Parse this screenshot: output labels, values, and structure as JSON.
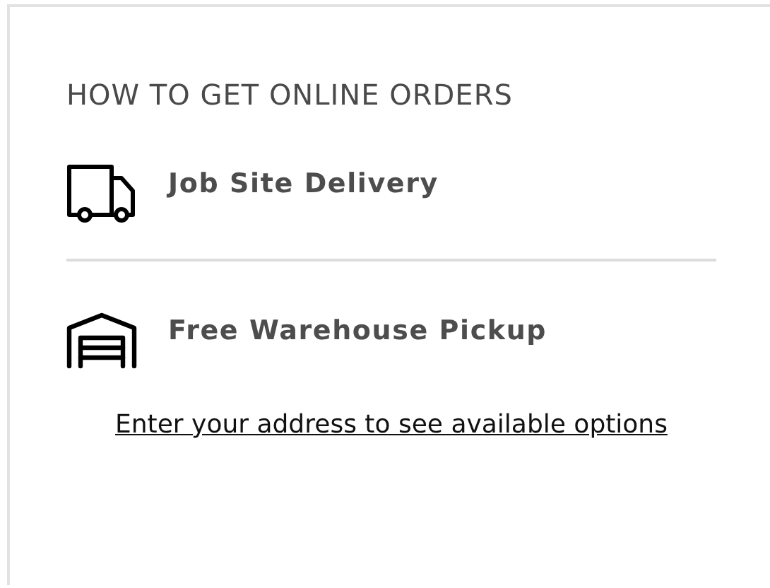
{
  "section": {
    "title": "HOW TO GET ONLINE ORDERS"
  },
  "options": [
    {
      "kind": "delivery",
      "label": "Job Site Delivery"
    },
    {
      "kind": "pickup",
      "label": "Free Warehouse Pickup"
    }
  ],
  "address_link": "Enter your address to see available options"
}
